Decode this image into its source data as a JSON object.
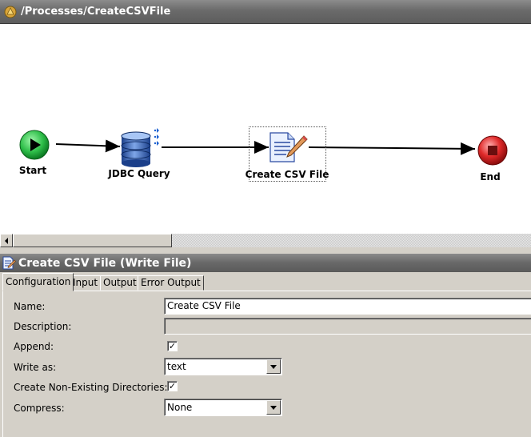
{
  "process": {
    "path": "/Processes/CreateCSVFile",
    "nodes": {
      "start": "Start",
      "jdbc": "JDBC Query",
      "csv": "Create CSV File",
      "end": "End"
    }
  },
  "activity": {
    "title": "Create CSV File (Write File)"
  },
  "tabs": [
    "Configuration",
    "Input",
    "Output",
    "Error Output"
  ],
  "config": {
    "name_label": "Name:",
    "name_value": "Create CSV File",
    "description_label": "Description:",
    "description_value": "",
    "append_label": "Append:",
    "append_checked": true,
    "write_as_label": "Write as:",
    "write_as_value": "text",
    "create_dirs_label": "Create Non-Existing Directories:",
    "create_dirs_checked": true,
    "compress_label": "Compress:",
    "compress_value": "None"
  },
  "icons": {
    "process": "process-icon",
    "start": "start-icon",
    "jdbc": "database-icon",
    "csv": "write-file-icon",
    "end": "end-icon",
    "activity": "write-file-icon"
  }
}
